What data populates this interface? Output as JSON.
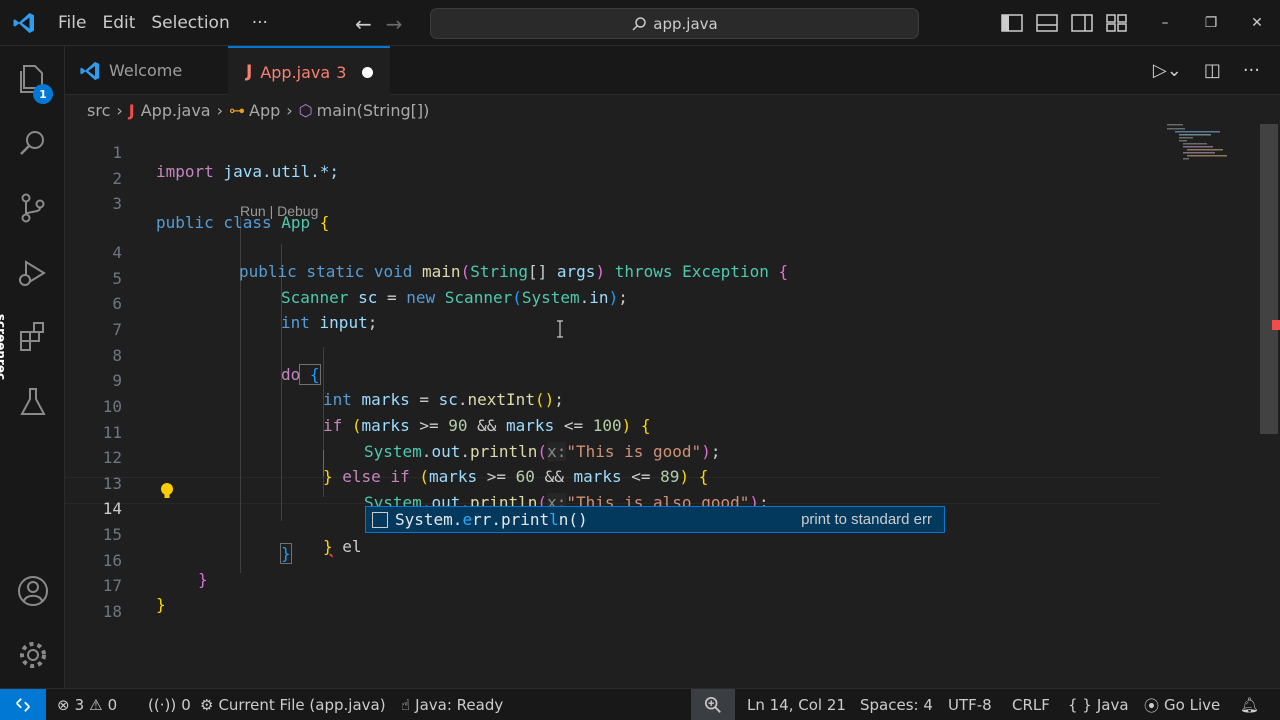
{
  "menu": [
    "File",
    "Edit",
    "Selection",
    "···"
  ],
  "search": {
    "text": "app.java"
  },
  "window_controls": [
    "–",
    "❐",
    "✕"
  ],
  "tabs": [
    {
      "label": "Welcome"
    },
    {
      "label": "App.java",
      "problems": "3",
      "icon": "J"
    }
  ],
  "explorer_badge": "1",
  "screenrec": "screenrec",
  "breadcrumb": {
    "folder": "src",
    "file": "App.java",
    "class": "App",
    "method": "main(String[])"
  },
  "codelens": "Run | Debug",
  "line_numbers": [
    "1",
    "2",
    "3",
    "4",
    "5",
    "6",
    "7",
    "8",
    "9",
    "10",
    "11",
    "12",
    "13",
    "14",
    "15",
    "16",
    "17",
    "18"
  ],
  "code": {
    "l1_kw": "import",
    "l1_rest": " java.util.*;",
    "l3_kw1": "public",
    "l3_kw2": " class",
    "l3_name": " App",
    "l3_brace": " {",
    "l4_kw": "public static void",
    "l4_fn": " main",
    "l4_p1": "(",
    "l4_ty": "String",
    "l4_arr": "[] ",
    "l4_var": "args",
    "l4_p2": ")",
    "l4_throws": " throws",
    "l4_ex": " Exception",
    "l4_brace": " {",
    "l5_ty": "Scanner",
    "l5_var": " sc",
    "l5_eq": " = ",
    "l5_new": "new",
    "l5_ty2": " Scanner",
    "l5_p1": "(",
    "l5_sys": "System",
    "l5_dot": ".",
    "l5_in": "in",
    "l5_p2": ")",
    "l5_end": ";",
    "l6_kw": "int",
    "l6_var": " input",
    "l6_end": ";",
    "l8_kw": "do",
    "l8_brace": " {",
    "l9_kw": "int",
    "l9_var": " marks",
    "l9_eq": " = ",
    "l9_sc": "sc",
    "l9_dot": ".",
    "l9_fn": "nextInt",
    "l9_p": "()",
    "l9_end": ";",
    "l10_kw": "if",
    "l10_p1": " (",
    "l10_v1": "marks",
    "l10_op1": " >= ",
    "l10_n1": "90",
    "l10_and": " && ",
    "l10_v2": "marks",
    "l10_op2": " <= ",
    "l10_n2": "100",
    "l10_p2": ")",
    "l10_brace": " {",
    "l11_sys": "System",
    "l11_dot1": ".",
    "l11_out": "out",
    "l11_dot2": ".",
    "l11_fn": "println",
    "l11_p1": "(",
    "l11_hint": "x:",
    "l11_str": "\"This is good\"",
    "l11_p2": ")",
    "l11_end": ";",
    "l12_brace": "}",
    "l12_kw": " else if",
    "l12_p1": " (",
    "l12_v1": "marks",
    "l12_op1": " >= ",
    "l12_n1": "60",
    "l12_and": " && ",
    "l12_v2": "marks",
    "l12_op2": " <= ",
    "l12_n2": "89",
    "l12_p2": ")",
    "l12_b2": " {",
    "l13_sys": "System",
    "l13_dot1": ".",
    "l13_out": "out",
    "l13_dot2": ".",
    "l13_fn": "println",
    "l13_p1": "(",
    "l13_hint": "x:",
    "l13_str": "\"This is also good\"",
    "l13_p2": ")",
    "l13_end": ";",
    "l14_brace": "}",
    "l14_rest": " el",
    "l15_brace": "}",
    "l16_brace": "}",
    "l17_brace": "}"
  },
  "suggest": {
    "label_pre": "System.",
    "label_match1": "e",
    "label_mid1": "rr.print",
    "label_match2": "l",
    "label_post": "n()",
    "detail": "print to standard err"
  },
  "status": {
    "errors": "3",
    "warnings": "0",
    "ports": "0",
    "current_file": "Current File (app.java)",
    "java": "Java: Ready",
    "position": "Ln 14, Col 21",
    "spaces": "Spaces: 4",
    "encoding": "UTF-8",
    "eol": "CRLF",
    "language": "Java",
    "golive": "Go Live"
  },
  "colors": {
    "accent": "#0078d4",
    "error": "#f14c4c",
    "background": "#1f1f1f"
  }
}
